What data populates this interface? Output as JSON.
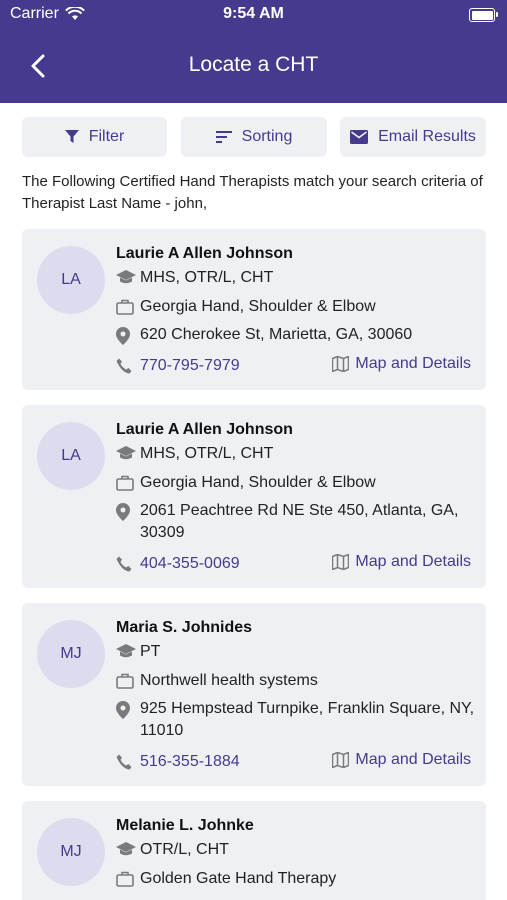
{
  "status": {
    "carrier": "Carrier",
    "time": "9:54 AM"
  },
  "header": {
    "title": "Locate a CHT"
  },
  "toolbar": {
    "filter": "Filter",
    "sorting": "Sorting",
    "email": "Email Results"
  },
  "intro": "The Following Certified Hand Therapists match your search criteria of Therapist Last Name - john,",
  "results": [
    {
      "initials": "LA",
      "name": "Laurie A Allen Johnson",
      "credentials": "MHS, OTR/L, CHT",
      "practice": "Georgia Hand, Shoulder & Elbow",
      "address": "620 Cherokee St, Marietta, GA, 30060",
      "phone": "770-795-7979",
      "map_label": "Map and Details"
    },
    {
      "initials": "LA",
      "name": "Laurie A Allen Johnson",
      "credentials": "MHS, OTR/L, CHT",
      "practice": "Georgia Hand, Shoulder & Elbow",
      "address": "2061 Peachtree Rd NE Ste 450, Atlanta, GA, 30309",
      "phone": "404-355-0069",
      "map_label": "Map and Details"
    },
    {
      "initials": "MJ",
      "name": "Maria S. Johnides",
      "credentials": "PT",
      "practice": "Northwell health systems",
      "address": "925 Hempstead Turnpike, Franklin Square, NY, 11010",
      "phone": "516-355-1884",
      "map_label": "Map and Details"
    },
    {
      "initials": "MJ",
      "name": "Melanie L. Johnke",
      "credentials": "OTR/L, CHT",
      "practice": "Golden Gate Hand Therapy"
    }
  ]
}
